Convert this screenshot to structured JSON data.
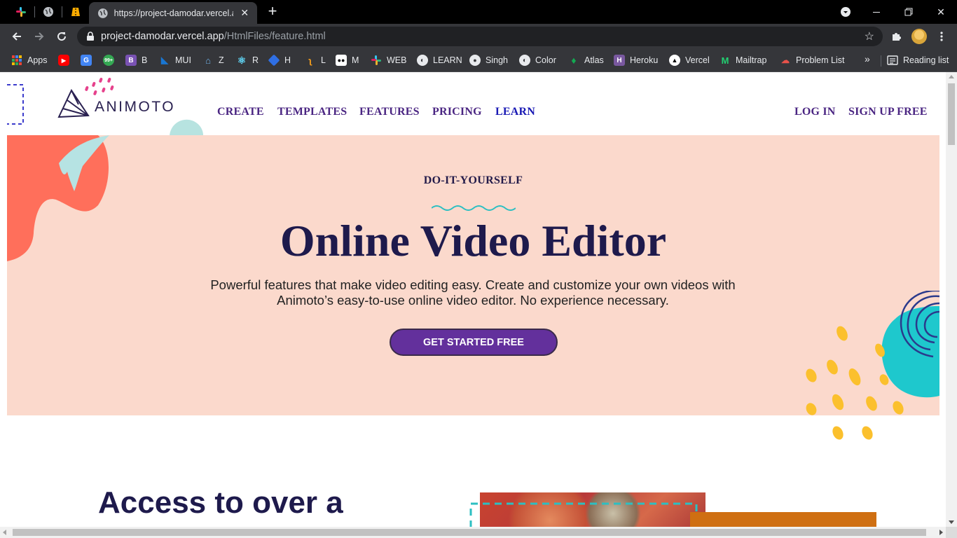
{
  "browser": {
    "active_tab_title": "https://project-damodar.vercel.ap",
    "url_host": "project-damodar.vercel.app",
    "url_path": "/HtmlFiles/feature.html",
    "bookmarks": [
      {
        "label": "Apps",
        "icon": "apps-grid-icon",
        "color": "#ea4335"
      },
      {
        "label": "",
        "icon": "youtube-icon",
        "color": "#ff0000"
      },
      {
        "label": "",
        "icon": "google-translate-icon",
        "color": "#4285f4"
      },
      {
        "label": "",
        "icon": "chat-icon",
        "color": "#34a853"
      },
      {
        "label": "B",
        "icon": "bootstrap-icon",
        "color": "#7952b3"
      },
      {
        "label": "MUI",
        "icon": "mui-icon",
        "color": "#1976d2"
      },
      {
        "label": "Z",
        "icon": "zoom-icon",
        "color": "#6fb0e6"
      },
      {
        "label": "R",
        "icon": "react-icon",
        "color": "#61dafb"
      },
      {
        "label": "H",
        "icon": "hackerrank-icon",
        "color": "#2f6fe4"
      },
      {
        "label": "L",
        "icon": "leetcode-icon",
        "color": "#f89f1b"
      },
      {
        "label": "M",
        "icon": "medium-icon",
        "color": "#ffffff"
      },
      {
        "label": "WEB",
        "icon": "slack-icon",
        "color": "#e01e5a"
      },
      {
        "label": "LEARN",
        "icon": "globe-icon",
        "color": "#e8eaed"
      },
      {
        "label": "Singh",
        "icon": "github-icon",
        "color": "#e8eaed"
      },
      {
        "label": "Color",
        "icon": "globe-icon",
        "color": "#e8eaed"
      },
      {
        "label": "Atlas",
        "icon": "mongodb-icon",
        "color": "#13aa52"
      },
      {
        "label": "Heroku",
        "icon": "heroku-icon",
        "color": "#79589f"
      },
      {
        "label": "Vercel",
        "icon": "vercel-icon",
        "color": "#ffffff"
      },
      {
        "label": "Mailtrap",
        "icon": "mailtrap-icon",
        "color": "#22d172"
      },
      {
        "label": "Problem List",
        "icon": "problem-list-icon",
        "color": "#e8524a"
      }
    ],
    "reading_list": "Reading list"
  },
  "site": {
    "logo_text": "ANIMOTO",
    "nav": {
      "create": "CREATE",
      "templates": "TEMPLATES",
      "features": "FEATURES",
      "pricing": "PRICING",
      "learn": "LEARN",
      "login": "LOG IN",
      "signup": "SIGN UP FREE"
    },
    "hero": {
      "eyebrow": "DO-IT-YOURSELF",
      "title": "Online Video Editor",
      "subtitle_line1": "Powerful features that make video editing easy. Create and customize your own videos with",
      "subtitle_line2": "Animoto’s easy-to-use online video editor. No experience necessary.",
      "cta": "GET STARTED FREE"
    },
    "section_heading": "Access to over a"
  },
  "colors": {
    "hero_bg": "#fbd9cc",
    "nav": "#4a2582",
    "cta": "#63309c",
    "heading": "#1e1a4c",
    "coral": "#ff6f5b",
    "teal": "#1ec8cd",
    "yellow": "#fbc02d"
  }
}
